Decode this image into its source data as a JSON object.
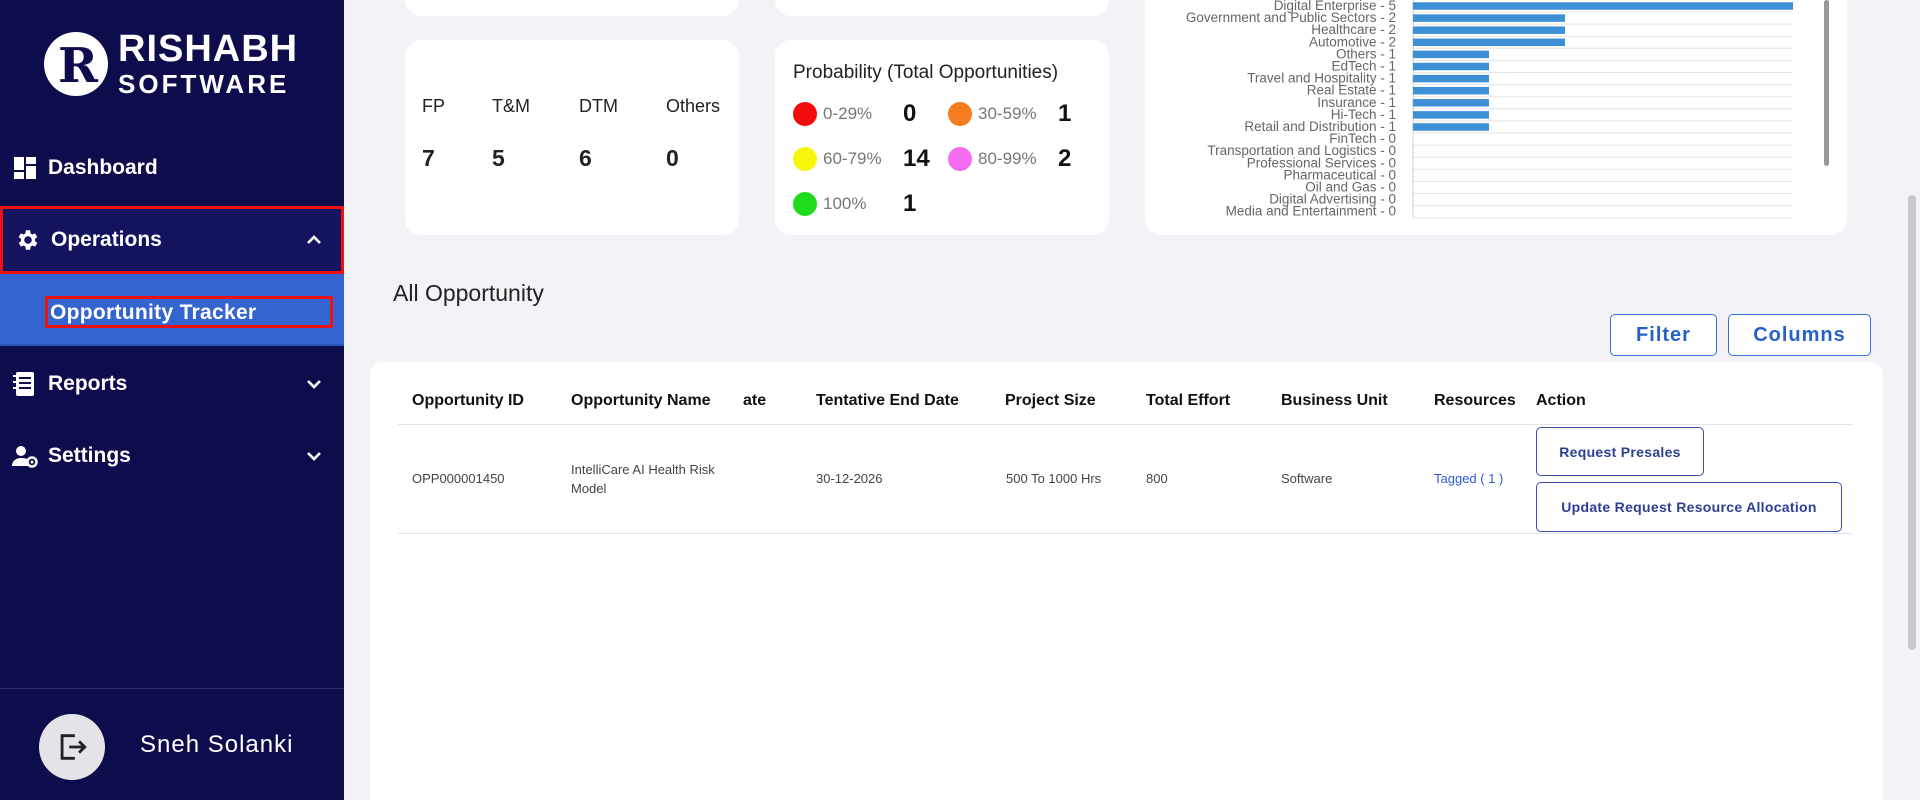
{
  "brand": {
    "name_line1": "RISHABH",
    "name_line2": "SOFTWARE",
    "mark": "R"
  },
  "sidebar": {
    "items": [
      {
        "label": "Dashboard",
        "icon": "dashboard-icon"
      },
      {
        "label": "Operations",
        "icon": "gear-icon",
        "expanded": true
      },
      {
        "label": "Reports",
        "icon": "report-icon"
      },
      {
        "label": "Settings",
        "icon": "user-settings-icon"
      }
    ],
    "submenu": {
      "label": "Opportunity Tracker"
    },
    "user": {
      "name": "Sneh Solanki",
      "icon": "logout-icon"
    }
  },
  "types": [
    {
      "label": "FP",
      "value": "7"
    },
    {
      "label": "T&M",
      "value": "5"
    },
    {
      "label": "DTM",
      "value": "6"
    },
    {
      "label": "Others",
      "value": "0"
    }
  ],
  "probability": {
    "title": "Probability (Total Opportunities)",
    "items": [
      {
        "label": "0-29%",
        "value": "0",
        "color": "#f40b0b"
      },
      {
        "label": "30-59%",
        "value": "1",
        "color": "#f57c1f"
      },
      {
        "label": "60-79%",
        "value": "14",
        "color": "#f8f60a"
      },
      {
        "label": "80-99%",
        "value": "2",
        "color": "#f56cf2"
      },
      {
        "label": "100%",
        "value": "1",
        "color": "#1fdc1f"
      }
    ]
  },
  "chart_data": {
    "type": "bar",
    "orientation": "horizontal",
    "bar_color": "#3d8fd6",
    "categories": [
      "Digital Enterprise - 5",
      "Government and Public Sectors - 2",
      "Healthcare - 2",
      "Automotive - 2",
      "Others - 1",
      "EdTech - 1",
      "Travel and Hospitality - 1",
      "Real Estate - 1",
      "Insurance - 1",
      "Hi-Tech - 1",
      "Retail and Distribution - 1",
      "FinTech - 0",
      "Transportation and Logistics - 0",
      "Professional Services - 0",
      "Pharmaceutical - 0",
      "Oil and Gas - 0",
      "Digital Advertising - 0",
      "Media and Entertainment - 0"
    ],
    "values": [
      5,
      2,
      2,
      2,
      1,
      1,
      1,
      1,
      1,
      1,
      1,
      0,
      0,
      0,
      0,
      0,
      0,
      0
    ],
    "xlim": [
      0,
      5
    ],
    "grid": true
  },
  "section": {
    "title": "All Opportunity",
    "filter_label": "Filter",
    "columns_label": "Columns"
  },
  "table": {
    "headers": [
      "Opportunity ID",
      "Opportunity Name",
      "ate",
      "Tentative End Date",
      "Project Size",
      "Total Effort",
      "Business Unit",
      "Resources",
      "Action"
    ],
    "rows": [
      {
        "id": "OPP000001450",
        "name": "IntelliCare AI Health Risk Model",
        "end_date": "30-12-2026",
        "project_size": "500 To 1000 Hrs",
        "total_effort": "800",
        "business_unit": "Software",
        "resources": "Tagged ( 1 )",
        "action_1": "Request Presales",
        "action_2": "Update Request Resource Allocation"
      }
    ]
  }
}
